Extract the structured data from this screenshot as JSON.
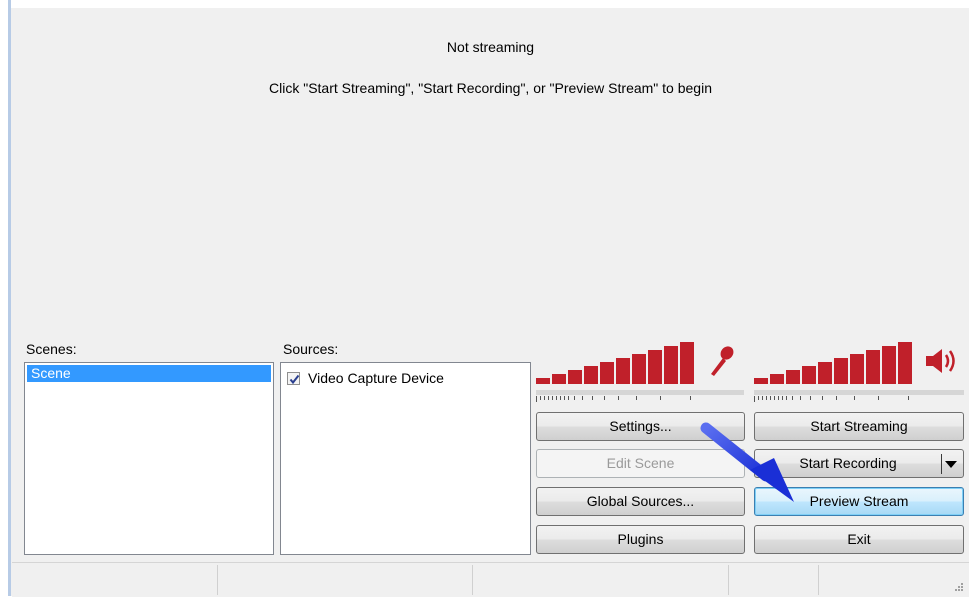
{
  "preview": {
    "status": "Not streaming",
    "hint": "Click \"Start Streaming\", \"Start Recording\", or \"Preview Stream\" to begin"
  },
  "scenes": {
    "label": "Scenes:",
    "items": [
      "Scene"
    ]
  },
  "sources": {
    "label": "Sources:",
    "items": [
      {
        "label": "Video Capture Device",
        "checked": true
      }
    ]
  },
  "buttons": {
    "settings": "Settings...",
    "edit_scene": "Edit Scene",
    "global_sources": "Global Sources...",
    "plugins": "Plugins",
    "start_streaming": "Start Streaming",
    "start_recording": "Start Recording",
    "preview_stream": "Preview Stream",
    "exit": "Exit"
  },
  "icons": {
    "mic": "microphone-icon",
    "speaker": "speaker-icon"
  },
  "colors": {
    "meter": "#c0202a",
    "selection": "#3399ff",
    "annotation_arrow": "#1a2fd6"
  }
}
